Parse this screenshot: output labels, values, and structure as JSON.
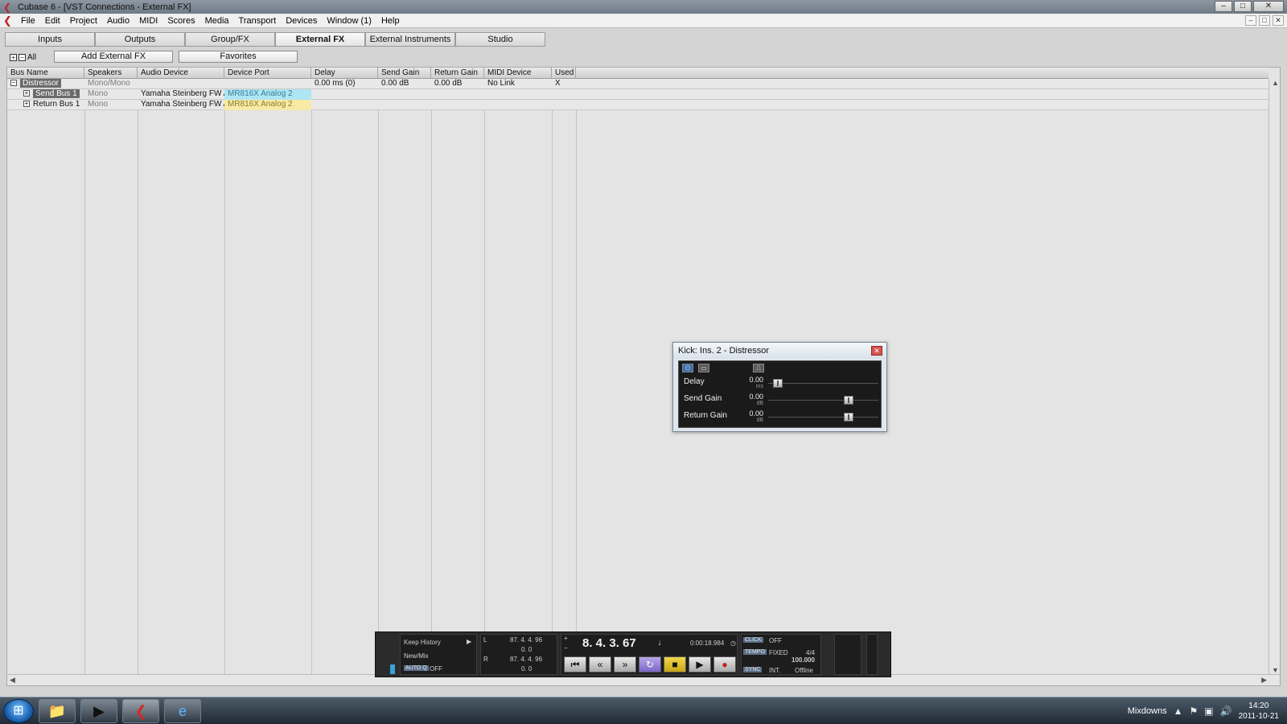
{
  "window": {
    "title": "Cubase 6 - [VST Connections - External FX]",
    "min": "–",
    "max": "□",
    "close": "✕"
  },
  "menu": [
    "File",
    "Edit",
    "Project",
    "Audio",
    "MIDI",
    "Scores",
    "Media",
    "Transport",
    "Devices",
    "Window (1)",
    "Help"
  ],
  "tabs": [
    "Inputs",
    "Outputs",
    "Group/FX",
    "External FX",
    "External Instruments",
    "Studio"
  ],
  "toolbar": {
    "all_label": "All",
    "add_button": "Add External FX",
    "favorites_button": "Favorites"
  },
  "columns": [
    "Bus Name",
    "Speakers",
    "Audio Device",
    "Device Port",
    "Delay",
    "Send Gain",
    "Return Gain",
    "MIDI Device",
    "Used"
  ],
  "rows": [
    {
      "name": "Distressor",
      "speakers": "Mono/Mono",
      "device": "",
      "port": "",
      "delay": "0.00 ms (0)",
      "send_gain": "0.00 dB",
      "return_gain": "0.00 dB",
      "midi": "No Link",
      "used": "X"
    },
    {
      "name": "Send Bus 1",
      "speakers": "Mono",
      "device": "Yamaha Steinberg FW AS",
      "port": "MR816X Analog 2",
      "delay": "",
      "send_gain": "",
      "return_gain": "",
      "midi": "",
      "used": ""
    },
    {
      "name": "Return Bus 1",
      "speakers": "Mono",
      "device": "Yamaha Steinberg FW AS",
      "port": "MR816X Analog 2",
      "delay": "",
      "send_gain": "",
      "return_gain": "",
      "midi": "",
      "used": ""
    }
  ],
  "plugin": {
    "title": "Kick: Ins. 2 - Distressor",
    "params": [
      {
        "label": "Delay",
        "value": "0.00",
        "unit": "ms",
        "level": 0.05
      },
      {
        "label": "Send Gain",
        "value": "0.00",
        "unit": "dB",
        "level": 0.75
      },
      {
        "label": "Return Gain",
        "value": "0.00",
        "unit": "dB",
        "level": 0.75
      }
    ]
  },
  "transport": {
    "keep_history": "Keep History",
    "new_mix": "New/Mix",
    "autoq": "AUTO Q",
    "autoq_state": "OFF",
    "left_locator": "87. 4. 4. 96",
    "left_small": "0.  0",
    "right_locator": "87. 4. 4. 96",
    "right_small": "0.  0",
    "position": "8. 4. 3. 67",
    "time": "0:00:18.984",
    "click_label": "CLICK",
    "click_state": "OFF",
    "tempo_label": "TEMPO",
    "tempo_mode": "FIXED",
    "signature": "4/4",
    "tempo_value": "100.000",
    "sync_label": "SYNC",
    "sync_mode": "INT.",
    "sync_state": "Offline"
  },
  "taskbar": {
    "tray_label": "Mixdowns",
    "time": "14:20",
    "date": "2011-10-21"
  }
}
